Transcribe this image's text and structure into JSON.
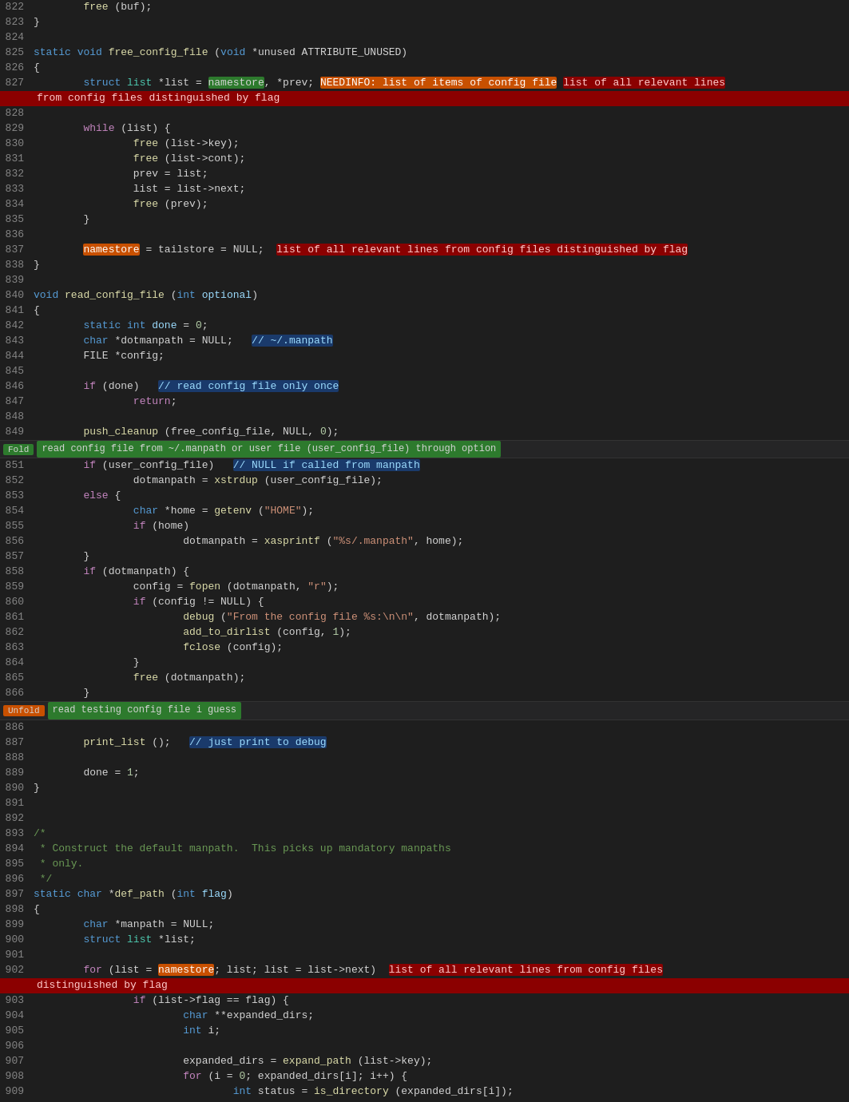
{
  "colors": {
    "bg": "#1e1e1e",
    "line_num": "#858585",
    "keyword": "#569cd6",
    "control": "#c586c0",
    "function": "#dcdcaa",
    "string": "#ce9178",
    "comment": "#6a9955",
    "number": "#b5cea8",
    "variable": "#9cdcfe",
    "type": "#4ec9b0",
    "plain": "#d4d4d4",
    "hl_green_bg": "#2d7a2d",
    "hl_red_bg": "#8b0000",
    "hl_orange_bg": "#c85000"
  },
  "fold1": {
    "button": "Fold",
    "description": "read config file from ~/.manpath or user file (user_config_file) through option"
  },
  "fold2": {
    "button": "Unfold",
    "description": "read testing config file i guess"
  }
}
